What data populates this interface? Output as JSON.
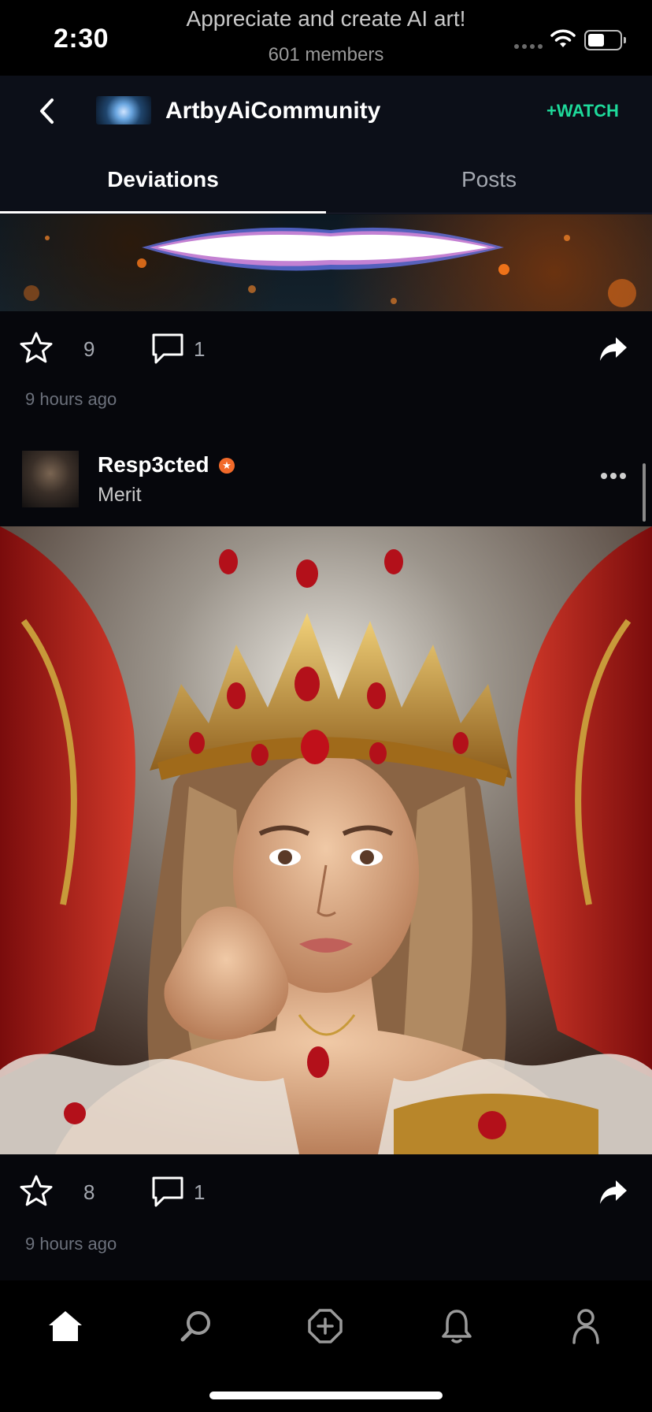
{
  "status_bar": {
    "time": "2:30",
    "title": "Appreciate and create AI art!",
    "members": "601 members",
    "icons": [
      "cellular-signal-icon",
      "wifi-icon",
      "battery-icon"
    ]
  },
  "header": {
    "back_icon": "chevron-left-icon",
    "group_name": "ArtbyAiCommunity",
    "watch_label": "+WATCH"
  },
  "tabs": [
    {
      "label": "Deviations",
      "active": true
    },
    {
      "label": "Posts",
      "active": false
    }
  ],
  "feed": [
    {
      "favorites": "9",
      "comments": "1",
      "time_ago": "9 hours ago"
    },
    {
      "author": "Resp3cted",
      "rank": "Merit",
      "favorites": "8",
      "comments": "1",
      "time_ago": "9 hours ago"
    }
  ],
  "bottom_nav": [
    {
      "icon": "home-icon",
      "active": true
    },
    {
      "icon": "search-icon",
      "active": false
    },
    {
      "icon": "create-icon",
      "active": false
    },
    {
      "icon": "bell-icon",
      "active": false
    },
    {
      "icon": "profile-icon",
      "active": false
    }
  ],
  "colors": {
    "background": "#06070c",
    "header": "#0c0f18",
    "watch_accent": "#1ed99a",
    "badge": "#f26a2a"
  }
}
